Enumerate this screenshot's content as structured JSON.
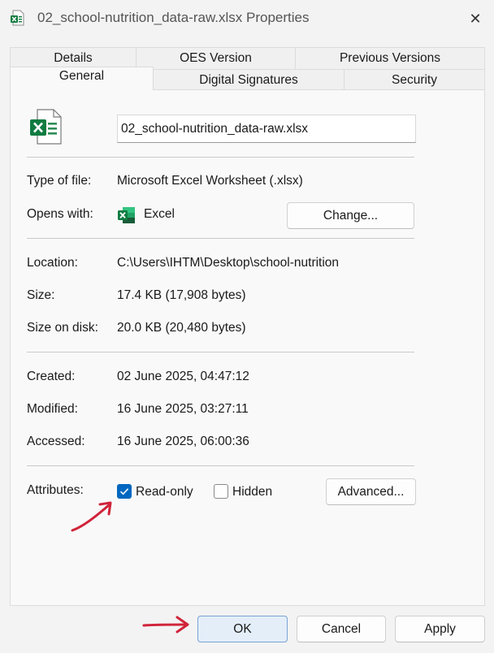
{
  "window": {
    "title": "02_school-nutrition_data-raw.xlsx Properties",
    "close_glyph": "✕"
  },
  "tabs": {
    "row_back": [
      "Details",
      "OES Version",
      "Previous Versions"
    ],
    "row_front": [
      "General",
      "Digital Signatures",
      "Security"
    ],
    "active": "General"
  },
  "general": {
    "file_name": "02_school-nutrition_data-raw.xlsx",
    "type_label": "Type of file:",
    "type_value": "Microsoft Excel Worksheet (.xlsx)",
    "opens_label": "Opens with:",
    "opens_value": "Excel",
    "change_button": "Change...",
    "location_label": "Location:",
    "location_value": "C:\\Users\\IHTM\\Desktop\\school-nutrition",
    "size_label": "Size:",
    "size_value": "17.4 KB (17,908 bytes)",
    "size_disk_label": "Size on disk:",
    "size_disk_value": "20.0 KB (20,480 bytes)",
    "created_label": "Created:",
    "created_value": "02 June 2025, 04:47:12",
    "modified_label": "Modified:",
    "modified_value": "16 June 2025, 03:27:11",
    "accessed_label": "Accessed:",
    "accessed_value": "16 June 2025, 06:00:36",
    "attributes_label": "Attributes:",
    "readonly_label": "Read-only",
    "readonly_checked": true,
    "hidden_label": "Hidden",
    "hidden_checked": false,
    "advanced_button": "Advanced..."
  },
  "footer": {
    "ok": "OK",
    "cancel": "Cancel",
    "apply": "Apply"
  },
  "colors": {
    "excel_green": "#107c41",
    "checkbox_blue": "#0067c0",
    "arrow_red": "#d0243a"
  }
}
